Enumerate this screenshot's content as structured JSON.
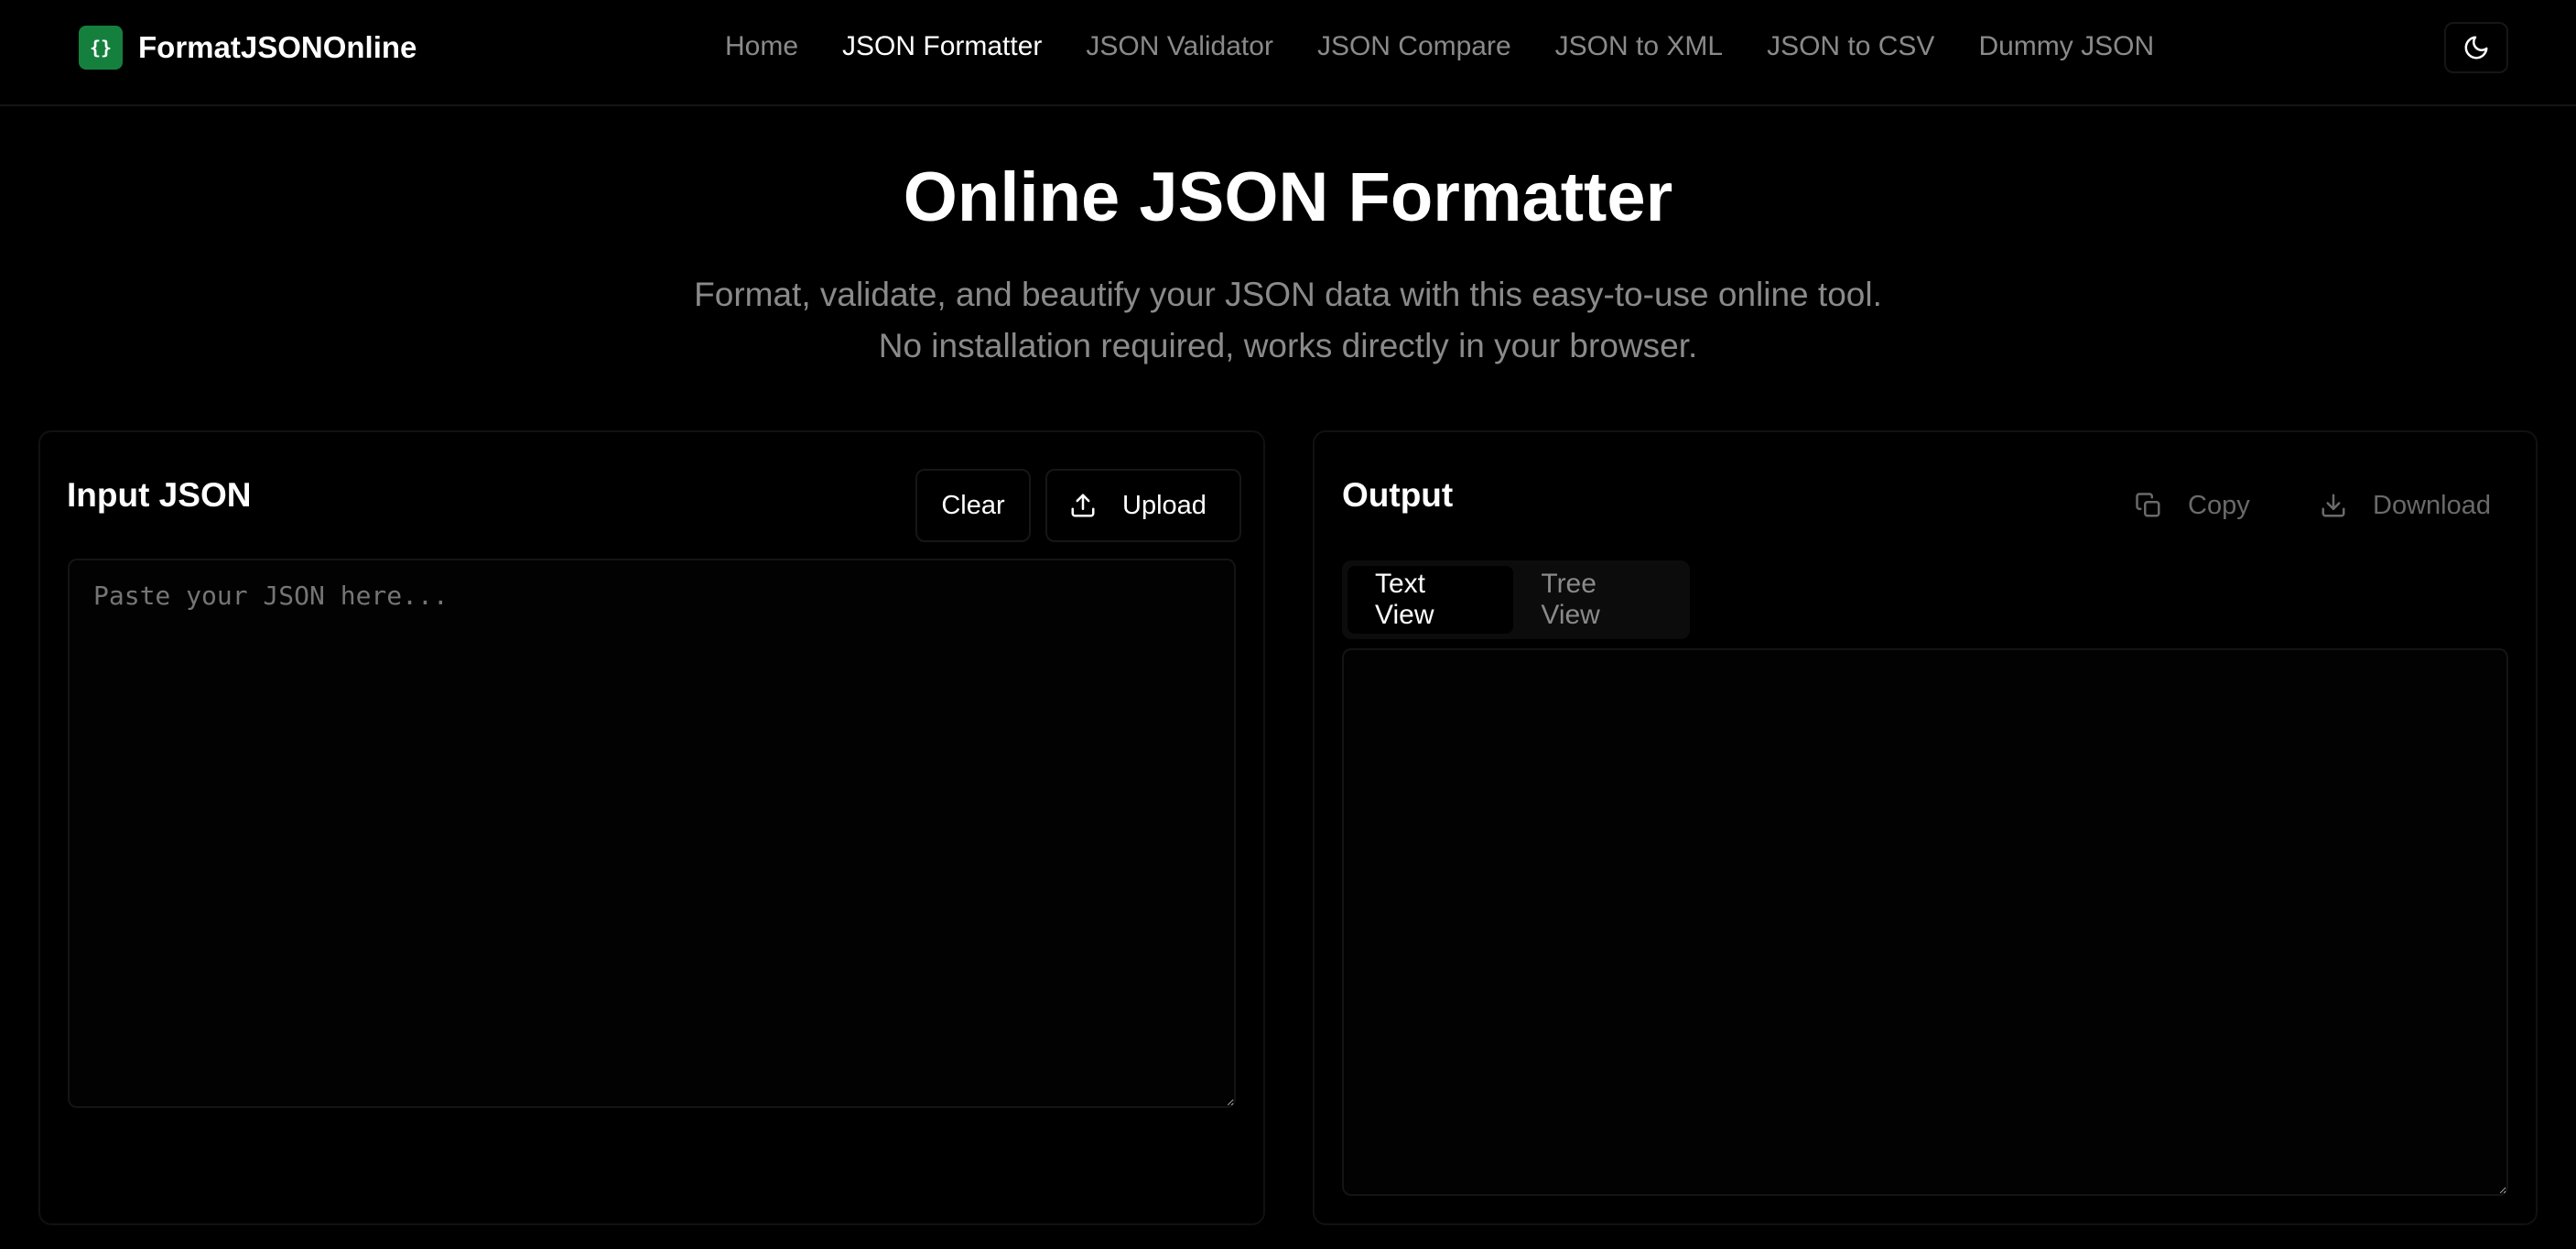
{
  "brand": {
    "logo_text": "{}",
    "name": "FormatJSONOnline"
  },
  "nav": {
    "items": [
      {
        "label": "Home"
      },
      {
        "label": "JSON Formatter",
        "active": true
      },
      {
        "label": "JSON Validator"
      },
      {
        "label": "JSON Compare"
      },
      {
        "label": "JSON to XML"
      },
      {
        "label": "JSON to CSV"
      },
      {
        "label": "Dummy JSON"
      }
    ],
    "theme_icon": "moon-icon"
  },
  "hero": {
    "title": "Online JSON Formatter",
    "subtitle": "Format, validate, and beautify your JSON data with this easy-to-use online tool. No installation required, works directly in your browser."
  },
  "input_panel": {
    "title": "Input JSON",
    "clear_label": "Clear",
    "upload_label": "Upload",
    "upload_icon": "upload-icon",
    "placeholder": "Paste your JSON here...",
    "value": ""
  },
  "output_panel": {
    "title": "Output",
    "copy_label": "Copy",
    "copy_icon": "copy-icon",
    "download_label": "Download",
    "download_icon": "download-icon",
    "tabs": [
      {
        "label": "Text View",
        "active": true
      },
      {
        "label": "Tree View"
      }
    ],
    "value": ""
  },
  "colors": {
    "accent": "#15803d",
    "background": "#000000",
    "muted_text": "#8a8a8a"
  }
}
